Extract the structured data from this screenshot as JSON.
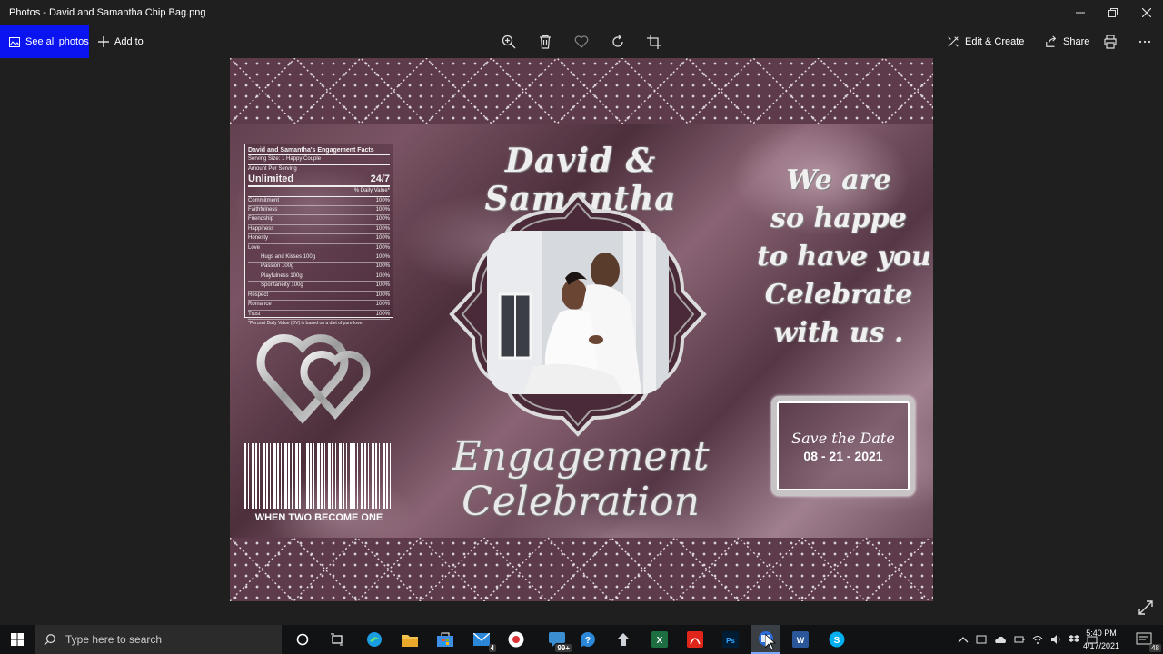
{
  "window": {
    "title": "Photos - David and Samantha Chip Bag.png"
  },
  "toolbar": {
    "see_all_photos": "See all photos",
    "add_to": "Add to",
    "edit_create": "Edit & Create",
    "share": "Share"
  },
  "photo": {
    "facts": {
      "title": "David and Samantha's Engagement Facts",
      "serving_size": "Serving Size: 1 Happy Couple",
      "amount_per_serving": "Amount Per Serving",
      "big_label": "Unlimited",
      "big_value": "24/7",
      "daily_value_header": "% Daily Value*",
      "rows": [
        {
          "label": "Commitment",
          "value": "100%",
          "indent": false
        },
        {
          "label": "Faithfulness",
          "value": "100%",
          "indent": false
        },
        {
          "label": "Friendship",
          "value": "100%",
          "indent": false
        },
        {
          "label": "Happiness",
          "value": "100%",
          "indent": false
        },
        {
          "label": "Honesty",
          "value": "100%",
          "indent": false
        },
        {
          "label": "Love",
          "value": "100%",
          "indent": false
        },
        {
          "label": "Hugs and Kisses 100g",
          "value": "100%",
          "indent": true
        },
        {
          "label": "Passion 100g",
          "value": "100%",
          "indent": true
        },
        {
          "label": "Playfulness 100g",
          "value": "100%",
          "indent": true
        },
        {
          "label": "Spontaneity 100g",
          "value": "100%",
          "indent": true
        },
        {
          "label": "Respect",
          "value": "100%",
          "indent": false
        },
        {
          "label": "Romance",
          "value": "100%",
          "indent": false
        },
        {
          "label": "Trust",
          "value": "100%",
          "indent": false
        }
      ],
      "footnote": "*Percent Daily Value (DV) is based on a diet of pure love."
    },
    "barcode_text": "WHEN TWO BECOME ONE",
    "names": "David & Samantha",
    "engagement_line1": "Engagement",
    "engagement_line2": "Celebration",
    "message_lines": [
      "We are",
      "so happe",
      "to have you",
      "Celebrate",
      "with us ."
    ],
    "save_the_date": "Save the Date",
    "date": "08 - 21 - 2021"
  },
  "taskbar": {
    "search_placeholder": "Type here to search",
    "mail_badge": "4",
    "badge_99": "99+",
    "time": "5:40 PM",
    "date": "4/17/2021",
    "notif_count": "48"
  }
}
